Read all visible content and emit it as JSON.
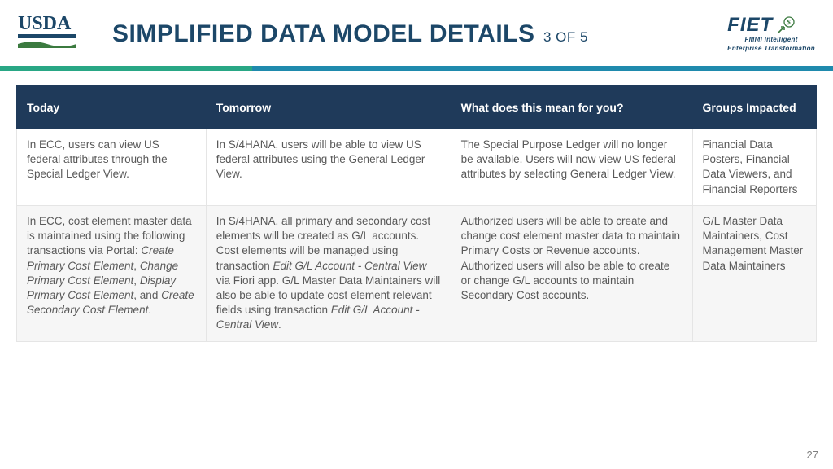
{
  "logos": {
    "usda_alt": "USDA",
    "fiet_label": "FIET",
    "fiet_sub1": "FMMI Intelligent",
    "fiet_sub2": "Enterprise Transformation"
  },
  "title": {
    "main": "SIMPLIFIED DATA MODEL DETAILS",
    "sub": "3 OF 5"
  },
  "headers": {
    "c1": "Today",
    "c2": "Tomorrow",
    "c3": "What does this mean for you?",
    "c4": "Groups Impacted"
  },
  "rows": [
    {
      "today": "In ECC, users can view US federal attributes through the Special Ledger View.",
      "tomorrow": "In S/4HANA, users will be able to view US federal attributes using the General Ledger View.",
      "meaning": "The Special Purpose Ledger will no longer be available. Users will now view US federal attributes by selecting General Ledger View.",
      "groups": "Financial Data Posters, Financial Data Viewers, and Financial Reporters"
    },
    {
      "today_pre": "In ECC, cost element master data is maintained using the following transactions via Portal: ",
      "today_i1": "Create Primary Cost Element",
      "today_s1": ", ",
      "today_i2": "Change Primary Cost Element",
      "today_s2": ", ",
      "today_i3": "Display Primary Cost Element",
      "today_s3": ", and ",
      "today_i4": "Create Secondary Cost Element",
      "today_s4": ".",
      "tomorrow_pre": "In S/4HANA, all primary and secondary cost elements will be created as G/L accounts. Cost elements will be managed using transaction ",
      "tomorrow_i1": "Edit G/L Account - Central View",
      "tomorrow_mid": " via Fiori app. G/L Master Data Maintainers will also be able to update cost element relevant fields using transaction ",
      "tomorrow_i2": "Edit G/L Account - Central View",
      "tomorrow_end": ".",
      "meaning": "Authorized users will be able to create and change cost element master data to maintain Primary Costs or Revenue accounts. Authorized users will also be able to create or change G/L accounts to maintain Secondary Cost accounts.",
      "groups": "G/L Master Data Maintainers, Cost Management Master Data Maintainers"
    }
  ],
  "page_number": "27"
}
